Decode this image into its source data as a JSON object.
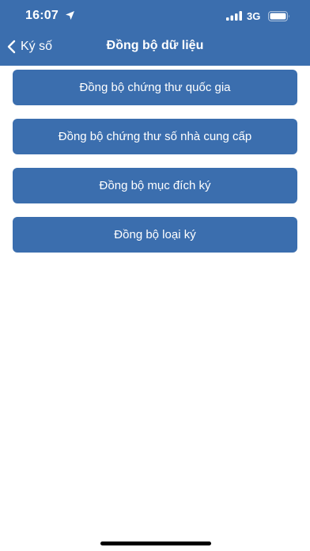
{
  "status_bar": {
    "time": "16:07",
    "network": "3G",
    "icons": [
      "location-arrow-icon",
      "cellular-signal-icon",
      "battery-icon"
    ]
  },
  "nav": {
    "back_label": "Ký số",
    "title": "Đồng bộ dữ liệu",
    "back_icon": "chevron-left-icon"
  },
  "menu": {
    "items": [
      {
        "label": "Đồng bộ chứng thư quốc gia"
      },
      {
        "label": "Đồng bộ chứng thư số nhà cung cấp"
      },
      {
        "label": "Đồng bộ mục đích ký"
      },
      {
        "label": "Đồng bộ loại ký"
      }
    ]
  },
  "colors": {
    "primary": "#3b6eae",
    "background": "#ffffff",
    "text_on_primary": "#ffffff"
  }
}
